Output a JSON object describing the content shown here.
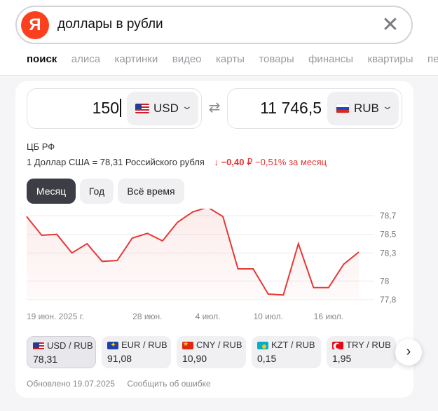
{
  "search": {
    "logo": "Я",
    "query": "доллары в рубли"
  },
  "tabs": [
    {
      "label": "поиск",
      "active": true
    },
    {
      "label": "алиса"
    },
    {
      "label": "картинки"
    },
    {
      "label": "видео"
    },
    {
      "label": "карты"
    },
    {
      "label": "товары"
    },
    {
      "label": "финансы"
    },
    {
      "label": "квартиры"
    },
    {
      "label": "пер"
    }
  ],
  "converter": {
    "from_amount": "150",
    "from_currency": "USD",
    "to_amount": "11 746,5",
    "to_currency": "RUB"
  },
  "source": "ЦБ РФ",
  "rate": {
    "text": "1 Доллар США = 78,31 Российского рубля",
    "change_abs": "−0,40",
    "change_pct": "−0,51% за месяц",
    "arrow": "↓"
  },
  "periods": [
    {
      "label": "Месяц",
      "active": true
    },
    {
      "label": "Год"
    },
    {
      "label": "Всё время"
    }
  ],
  "chart_data": {
    "type": "line",
    "x_labels": [
      "19 июн. 2025 г.",
      "28 июн.",
      "4 июл.",
      "10 июл.",
      "16 июл."
    ],
    "y_ticks": [
      "78,7",
      "78,5",
      "78,3",
      "78",
      "77,8"
    ],
    "y_tick_values": [
      78.7,
      78.5,
      78.3,
      78.0,
      77.8
    ],
    "ylim": [
      77.8,
      78.7
    ],
    "values": [
      78.69,
      78.49,
      78.5,
      78.3,
      78.4,
      78.21,
      78.22,
      78.46,
      78.51,
      78.43,
      78.63,
      78.74,
      78.79,
      78.69,
      78.13,
      78.13,
      77.86,
      77.85,
      78.4,
      77.93,
      77.93,
      78.18,
      78.31
    ],
    "line_color": "#e53935"
  },
  "pairs": [
    {
      "name": "USD / RUB",
      "value": "78,31",
      "flag": "us",
      "active": true
    },
    {
      "name": "EUR / RUB",
      "value": "91,08",
      "flag": "eu"
    },
    {
      "name": "CNY / RUB",
      "value": "10,90",
      "flag": "cn"
    },
    {
      "name": "KZT / RUB",
      "value": "0,15",
      "flag": "kz"
    },
    {
      "name": "TRY / RUB",
      "value": "1,95",
      "flag": "tr"
    }
  ],
  "footer": {
    "updated": "Обновлено 19.07.2025",
    "report": "Сообщить об ошибке"
  }
}
